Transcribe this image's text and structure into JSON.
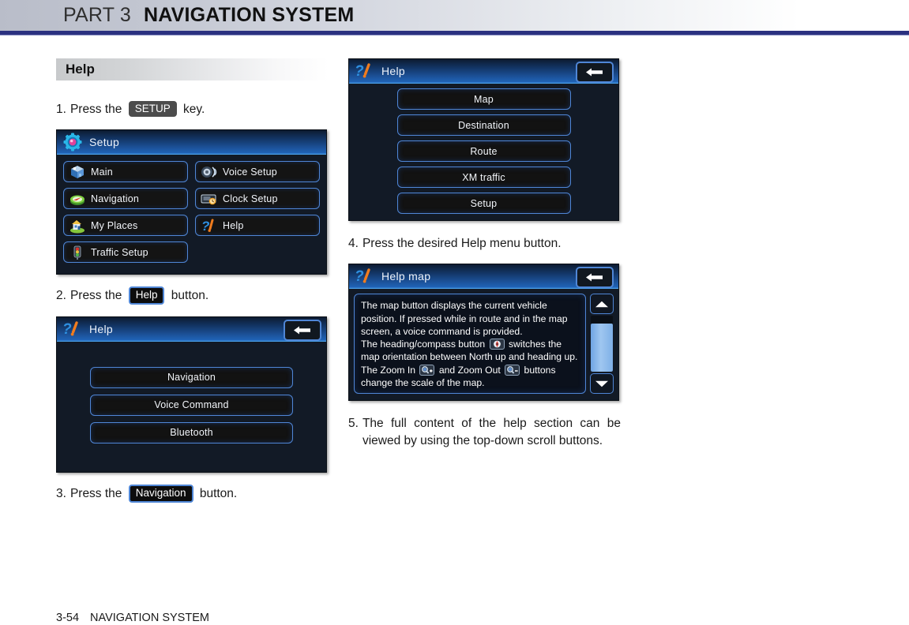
{
  "header": {
    "part_label": "PART 3",
    "title": "NAVIGATION SYSTEM"
  },
  "section": {
    "title": "Help"
  },
  "steps": {
    "s1": {
      "num": "1.",
      "pre": "Press the ",
      "badge": "SETUP",
      "post": " key."
    },
    "s2": {
      "num": "2.",
      "pre": "Press the ",
      "badge": "Help",
      "post": " button."
    },
    "s3": {
      "num": "3.",
      "pre": "Press the ",
      "badge": "Navigation",
      "post": " button."
    },
    "s4": {
      "num": "4.",
      "text": "Press the desired Help menu button."
    },
    "s5": {
      "num": "5.",
      "text": "The full content of the help section can be viewed by using the top-down scroll buttons."
    }
  },
  "setup_screen": {
    "title": "Setup",
    "title_icon": "gear-icon",
    "buttons": [
      {
        "label": "Main",
        "icon": "cube-icon"
      },
      {
        "label": "Voice Setup",
        "icon": "speaker-icon"
      },
      {
        "label": "Navigation",
        "icon": "compass-disc-icon"
      },
      {
        "label": "Clock Setup",
        "icon": "clock-panel-icon"
      },
      {
        "label": "My Places",
        "icon": "house-icon"
      },
      {
        "label": "Help",
        "icon": "question-icon"
      },
      {
        "label": "Traffic Setup",
        "icon": "traffic-light-icon"
      }
    ]
  },
  "help_screen_1": {
    "title": "Help",
    "title_icon": "question-icon",
    "back_icon": "back-arrow-icon",
    "buttons": [
      "Navigation",
      "Voice Command",
      "Bluetooth"
    ]
  },
  "help_screen_2": {
    "title": "Help",
    "title_icon": "question-icon",
    "back_icon": "back-arrow-icon",
    "buttons": [
      "Map",
      "Destination",
      "Route",
      "XM traffic",
      "Setup"
    ]
  },
  "help_map_screen": {
    "title": "Help map",
    "title_icon": "question-icon",
    "back_icon": "back-arrow-icon",
    "text": {
      "p1": "The map button displays the current vehicle position. If pressed while in route and in the map screen, a voice command is provided.",
      "p2a": "The heading/compass button ",
      "p2b": " switches the map orientation between North up and heading up.",
      "p3a": "The Zoom In ",
      "p3b": " and Zoom Out ",
      "p3c": " buttons change the scale of the map."
    },
    "icons": {
      "compass": "compass-button-icon",
      "zoom_in": "zoom-in-icon",
      "zoom_out": "zoom-out-icon",
      "scroll_up": "scroll-up-icon",
      "scroll_down": "scroll-down-icon",
      "scrollbar": "vertical-scrollbar"
    }
  },
  "footer": {
    "page_number": "3-54",
    "section_name": "NAVIGATION SYSTEM"
  },
  "colors": {
    "rule": "#2b3180",
    "screen_bg": "#121a26",
    "button_border": "#4f86d6",
    "titlebar_blue": "#1b4f94",
    "scroll_fill": "#7fb0e7"
  }
}
